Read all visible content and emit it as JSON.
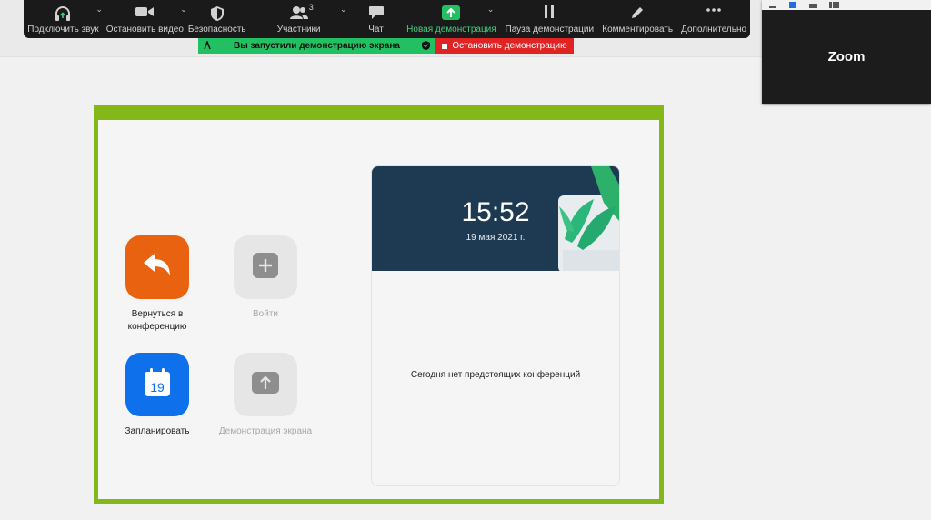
{
  "toolbar": {
    "items": [
      {
        "label": "Подключить звук",
        "icon": "headphones-icon"
      },
      {
        "label": "Остановить видео",
        "icon": "video-camera-icon"
      },
      {
        "label": "Безопасность",
        "icon": "shield-icon"
      },
      {
        "label": "Участники",
        "icon": "participants-icon",
        "count": "3"
      },
      {
        "label": "Чат",
        "icon": "chat-icon"
      },
      {
        "label": "Новая демонстрация",
        "icon": "share-screen-icon"
      },
      {
        "label": "Пауза демонстрации",
        "icon": "pause-icon"
      },
      {
        "label": "Комментировать",
        "icon": "pencil-icon"
      },
      {
        "label": "Дополнительно",
        "icon": "more-icon"
      }
    ],
    "accent_color": "#3fd17a"
  },
  "banner": {
    "sharing_text": "Вы запустили демонстрацию экрана",
    "stop_text": "Остановить демонстрацию",
    "green_color": "#23c063",
    "red_color": "#e02424"
  },
  "video_thumb": {
    "label": "Zoom"
  },
  "app": {
    "actions": [
      {
        "label": "Вернуться в конференцию",
        "icon": "return-arrow-icon",
        "color": "#e8620f",
        "enabled": true
      },
      {
        "label": "Войти",
        "icon": "plus-icon",
        "color": "#e6e6e6",
        "enabled": false
      },
      {
        "label": "Запланировать",
        "icon": "calendar-icon",
        "calendar_day": "19",
        "color": "#0e71eb",
        "enabled": true
      },
      {
        "label": "Демонстрация экрана",
        "icon": "upload-arrow-icon",
        "color": "#e6e6e6",
        "enabled": false
      }
    ],
    "clock": {
      "time": "15:52",
      "date": "19 мая 2021 г."
    },
    "no_meetings": "Сегодня нет предстоящих конференций"
  },
  "frame_color": "#84b818"
}
